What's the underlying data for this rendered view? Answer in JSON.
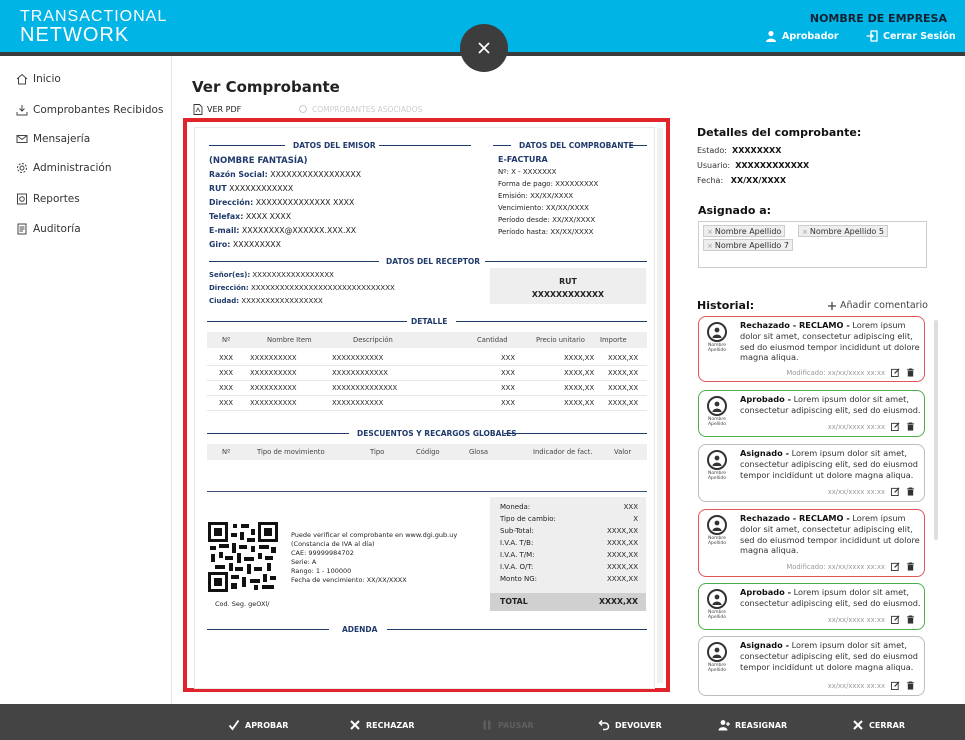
{
  "header": {
    "logo_line1": "TRANSACTIONAL",
    "logo_line2": "NETWORK",
    "company": "NOMBRE DE EMPRESA",
    "approved_label": "Aprobador",
    "logout_label": "Cerrar Sesión",
    "brand_color": "#00b4e6"
  },
  "sidebar": {
    "items": [
      {
        "label": "Inicio",
        "icon": "home-icon"
      },
      {
        "label": "Comprobantes Recibidos",
        "icon": "inbox-download-icon"
      },
      {
        "label": "Mensajería",
        "icon": "mail-icon"
      },
      {
        "label": "Administración",
        "icon": "gear-icon"
      },
      {
        "label": "Reportes",
        "icon": "report-icon"
      },
      {
        "label": "Auditoría",
        "icon": "audit-icon"
      }
    ]
  },
  "main": {
    "title": "Ver Comprobante",
    "pdf_label": "VER PDF",
    "assoc_label": "COMPROBANTES ASOCIADOS"
  },
  "doc": {
    "emisor": {
      "title": "DATOS DEL EMISOR",
      "fantasia": "(NOMBRE FANTASÍA)",
      "razon_label": "Razón Social:",
      "razon_value": "XXXXXXXXXXXXXXXXX",
      "rut_label": "RUT",
      "rut_value": "XXXXXXXXXXXX",
      "dir_label": "Dirección:",
      "dir_value": "XXXXXXXXXXXXXX XXXX",
      "tel_label": "Telefax:",
      "tel_value": "XXXX XXXX",
      "email_label": "E-mail:",
      "email_value": "XXXXXXXX@XXXXXX.XXX.XX",
      "giro_label": "Giro:",
      "giro_value": "XXXXXXXXX"
    },
    "comprobante": {
      "title": "DATOS DEL COMPROBANTE",
      "type": "E-FACTURA",
      "lines": [
        "Nº: X - XXXXXXX",
        "Forma de pago: XXXXXXXXX",
        "Emisión: XX/XX/XXXX",
        "Vencimiento: XX/XX/XXXX",
        "Período desde: XX/XX/XXXX",
        "Período hasta: XX/XX/XXXX"
      ]
    },
    "receptor": {
      "title": "DATOS DEL RECEPTOR",
      "senores_label": "Señor(es):",
      "senores_value": "XXXXXXXXXXXXXXXXX",
      "dir_label": "Dirección:",
      "dir_value": "XXXXXXXXXXXXXXXXXXXXXXXXXXXXXX",
      "ciudad_label": "Ciudad:",
      "ciudad_value": "XXXXXXXXXXXXXXXXX",
      "rut_label": "RUT",
      "rut_value": "XXXXXXXXXXXX"
    },
    "detalle": {
      "title": "DETALLE",
      "headers": [
        "Nº",
        "Nombre Item",
        "Descripción",
        "Cantidad",
        "Precio unitario",
        "Importe"
      ],
      "rows": [
        [
          "XXX",
          "XXXXXXXXXX",
          "XXXXXXXXXXX",
          "XXX",
          "XXXX,XX",
          "XXXX,XX"
        ],
        [
          "XXX",
          "XXXXXXXXXX",
          "XXXXXXXXXXXX",
          "XXX",
          "XXXX,XX",
          "XXXX,XX"
        ],
        [
          "XXX",
          "XXXXXXXXXX",
          "XXXXXXXXXXXXXX",
          "XXX",
          "XXXX,XX",
          "XXXX,XX"
        ],
        [
          "XXX",
          "XXXXXXXXXX",
          "XXXXXXXXXXX",
          "XXX",
          "XXXX,XX",
          "XXXX,XX"
        ]
      ]
    },
    "descuentos": {
      "title": "DESCUENTOS Y RECARGOS GLOBALES",
      "headers": [
        "Nº",
        "Tipo de movimiento",
        "Tipo",
        "Código",
        "Glosa",
        "Indicador de fact.",
        "Valor"
      ]
    },
    "verify": {
      "lines": [
        "Puede verificar el comprobante en www.dgi.gub.uy",
        "(Constancia de IVA al día)",
        "CAE: 99999984702",
        "Serie: A",
        "Rango: 1 - 100000",
        "Fecha de vencimiento: XX/XX/XXXX"
      ],
      "cod_seg": "Cod. Seg. geOXl/"
    },
    "totals": {
      "rows": [
        [
          "Moneda:",
          "XXX"
        ],
        [
          "Tipo de cambio:",
          "X"
        ],
        [
          "Sub-Total:",
          "XXXX,XX"
        ],
        [
          "I.V.A. T/B:",
          "XXXX,XX"
        ],
        [
          "I.V.A. T/M:",
          "XXXX,XX"
        ],
        [
          "I.V.A. O/T:",
          "XXXX,XX"
        ],
        [
          "Monto NG:",
          "XXXX,XX"
        ]
      ],
      "total_label": "TOTAL",
      "total_value": "XXXX,XX"
    },
    "adenda": "ADENDA"
  },
  "details": {
    "title": "Detalles del comprobante:",
    "estado_label": "Estado:",
    "estado_value": "XXXXXXXX",
    "usuario_label": "Usuario:",
    "usuario_value": "XXXXXXXXXXXX",
    "fecha_label": "Fecha:",
    "fecha_value": "XX/XX/XXXX"
  },
  "asignado": {
    "title": "Asignado a:",
    "chips": [
      "Nombre Apellido",
      "Nombre Apellido 5",
      "Nombre Apellido 7"
    ]
  },
  "historial": {
    "title": "Historial:",
    "add_label": "Añadir comentario",
    "cards": [
      {
        "status": "Rechazado - RECLAMO -",
        "text": "Lorem ipsum dolor sit amet, consectetur adipiscing elit, sed do eiusmod tempor incididunt ut dolore magna aliqua.",
        "footer": "Modificado: xx/xx/xxxx xx:xx",
        "variant": "red",
        "name": "Nombre Apellido"
      },
      {
        "status": "Aprobado -",
        "text": "Lorem ipsum dolor sit amet, consectetur adipiscing elit, sed do eiusmod.",
        "footer": "xx/xx/xxxx xx:xx",
        "variant": "green",
        "name": "Nombre Apellido"
      },
      {
        "status": "Asignado -",
        "text": "Lorem ipsum dolor sit amet, consectetur adipiscing elit, sed do eiusmod tempor incididunt ut dolore magna aliqua.",
        "footer": "xx/xx/xxxx xx:xx",
        "variant": "gray",
        "name": "Nombre Apellido"
      },
      {
        "status": "Rechazado - RECLAMO -",
        "text": "Lorem ipsum dolor sit amet, consectetur adipiscing elit, sed do eiusmod tempor incididunt ut dolore magna aliqua.",
        "footer": "Modificado: xx/xx/xxxx xx:xx",
        "variant": "red",
        "name": "Nombre Apellido"
      },
      {
        "status": "Aprobado -",
        "text": "Lorem ipsum dolor sit amet, consectetur adipiscing elit, sed do eiusmod.",
        "footer": "xx/xx/xxxx xx:xx",
        "variant": "green",
        "name": "Nombre Apellido"
      },
      {
        "status": "Asignado -",
        "text": "Lorem ipsum dolor sit amet, consectetur adipiscing elit, sed do eiusmod tempor incididunt ut dolore magna aliqua.",
        "footer": "xx/xx/xxxx xx:xx",
        "variant": "gray",
        "name": "Nombre Apellido"
      }
    ]
  },
  "bottombar": {
    "aprobar": "APROBAR",
    "rechazar": "RECHAZAR",
    "pausar": "PAUSAR",
    "devolver": "DEVOLVER",
    "reasignar": "REASIGNAR",
    "cerrar": "CERRAR"
  }
}
